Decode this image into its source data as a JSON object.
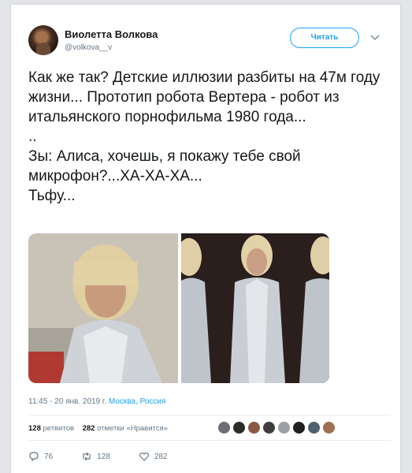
{
  "author": {
    "name": "Виолетта Волкова",
    "handle": "@volkova__v"
  },
  "follow_label": "Читать",
  "tweet": {
    "text": "Как же так? Детские иллюзии разбиты на 47м году жизни... Прототип робота Вертера - робот из итальянского порнофильма 1980 года...\n..\nЗы: Алиса, хочешь, я покажу тебе свой микрофон?...ХА-ХА-ХА...\nТьфу..."
  },
  "meta": {
    "time": "11:45 - 20 янв. 2019 г.",
    "location": "Москва, Россия"
  },
  "stats": {
    "retweets_count": "128",
    "retweets_label": "ретвитов",
    "likes_count": "282",
    "likes_label": "отметки «Нравится»"
  },
  "actions": {
    "replies": "76",
    "retweets": "128",
    "likes": "282"
  },
  "colors": {
    "accent": "#1da1f2",
    "text": "#14171a",
    "muted": "#657786"
  },
  "icons": [
    "chevron-down-icon",
    "reply-icon",
    "retweet-icon",
    "heart-icon"
  ]
}
